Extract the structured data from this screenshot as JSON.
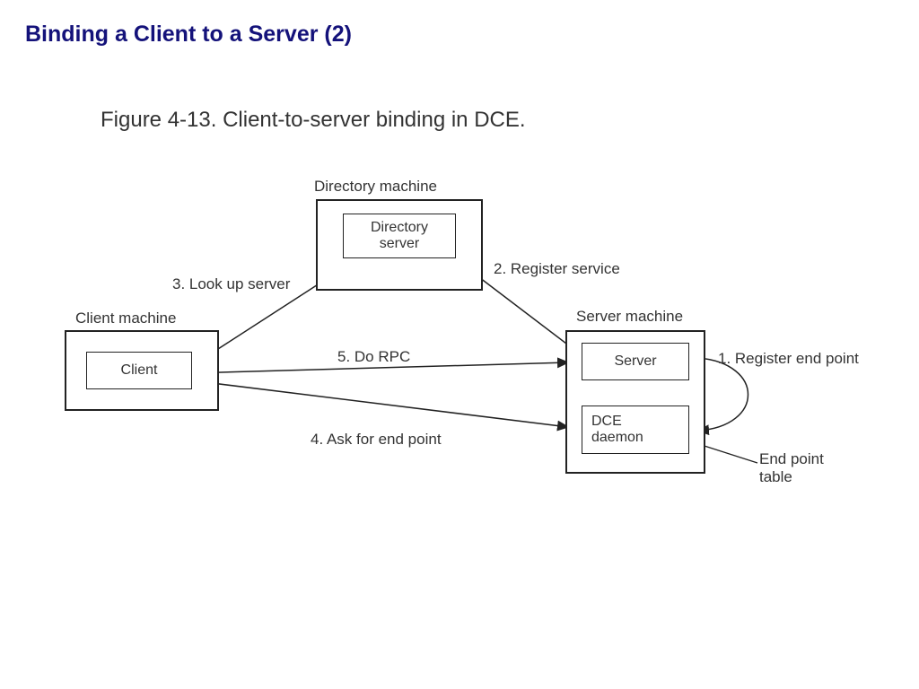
{
  "title": "Binding a Client to a Server (2)",
  "caption": "Figure 4-13. Client-to-server binding in DCE.",
  "machines": {
    "client": {
      "label": "Client machine",
      "inner": "Client"
    },
    "directory": {
      "label": "Directory machine",
      "inner": "Directory\nserver"
    },
    "server": {
      "label": "Server machine",
      "server_inner": "Server",
      "daemon_inner": "DCE\ndaemon"
    }
  },
  "steps": {
    "s1": "1. Register end point",
    "s2": "2. Register service",
    "s3": "3. Look up server",
    "s4": "4. Ask for end point",
    "s5": "5. Do RPC"
  },
  "extra": {
    "end_point_table": "End point\ntable"
  }
}
